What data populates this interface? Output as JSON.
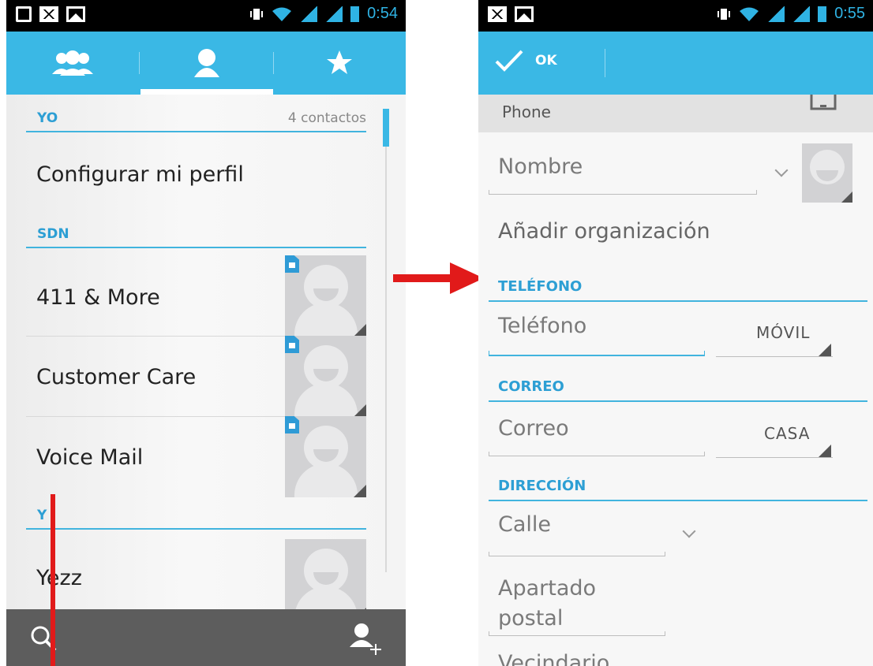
{
  "left": {
    "status": {
      "time": "0:54"
    },
    "tabs": [
      {
        "icon": "groups-icon"
      },
      {
        "icon": "person-icon",
        "active": true
      },
      {
        "icon": "star-icon"
      }
    ],
    "sections": {
      "yo": {
        "title": "YO",
        "count": "4 contactos"
      },
      "sdn": {
        "title": "SDN"
      },
      "y": {
        "title": "Y"
      }
    },
    "items": {
      "profile": "Configurar mi perfil",
      "sdn": [
        "411 & More",
        "Customer Care",
        "Voice Mail"
      ],
      "y": [
        "Yezz"
      ]
    },
    "bottom": {
      "search_icon": "search-icon",
      "add_icon": "add-contact-icon"
    }
  },
  "right": {
    "status": {
      "time": "0:55"
    },
    "ok_label": "OK",
    "account_label": "Phone",
    "name_placeholder": "Nombre",
    "add_org": "Añadir organización",
    "sections": {
      "phone": "TELÉFONO",
      "email": "CORREO",
      "address": "DIRECCIÓN"
    },
    "phone_placeholder": "Teléfono",
    "phone_type": "MÓVIL",
    "email_placeholder": "Correo",
    "email_type": "CASA",
    "street_placeholder": "Calle",
    "pobox_line1": "Apartado",
    "pobox_line2": "postal",
    "neighborhood_partial": "Vecindario"
  },
  "colors": {
    "accent": "#3ab8e5",
    "section_text": "#2d9fd4",
    "annotation_red": "#e11a1a"
  }
}
